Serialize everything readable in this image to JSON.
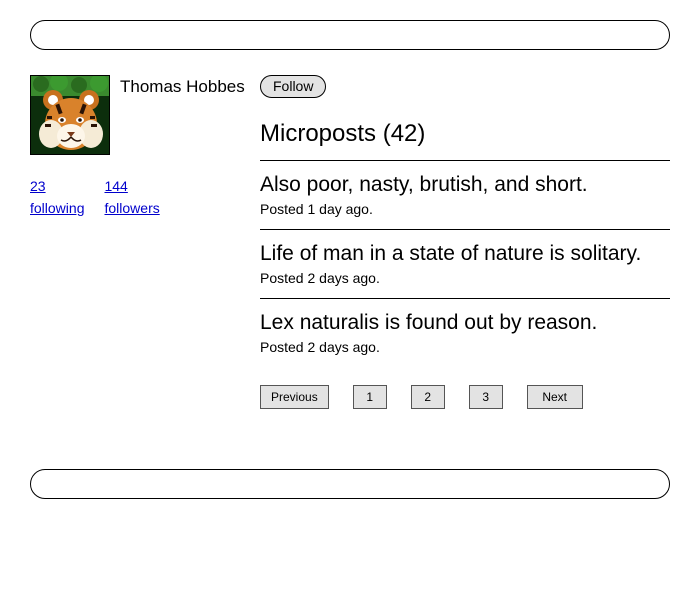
{
  "user": {
    "name": "Thomas Hobbes"
  },
  "stats": {
    "following_count": "23",
    "following_label": "following",
    "followers_count": "144",
    "followers_label": "followers"
  },
  "actions": {
    "follow_label": "Follow"
  },
  "microposts": {
    "heading": "Microposts (42)",
    "items": [
      {
        "body": "Also poor, nasty, brutish, and short.",
        "meta": "Posted 1 day ago."
      },
      {
        "body": "Life of man in a state of nature is solitary.",
        "meta": "Posted 2 days ago."
      },
      {
        "body": "Lex naturalis is found out by reason.",
        "meta": "Posted 2 days ago."
      }
    ]
  },
  "pagination": {
    "prev": "Previous",
    "pages": [
      "1",
      "2",
      "3"
    ],
    "next": "Next"
  }
}
